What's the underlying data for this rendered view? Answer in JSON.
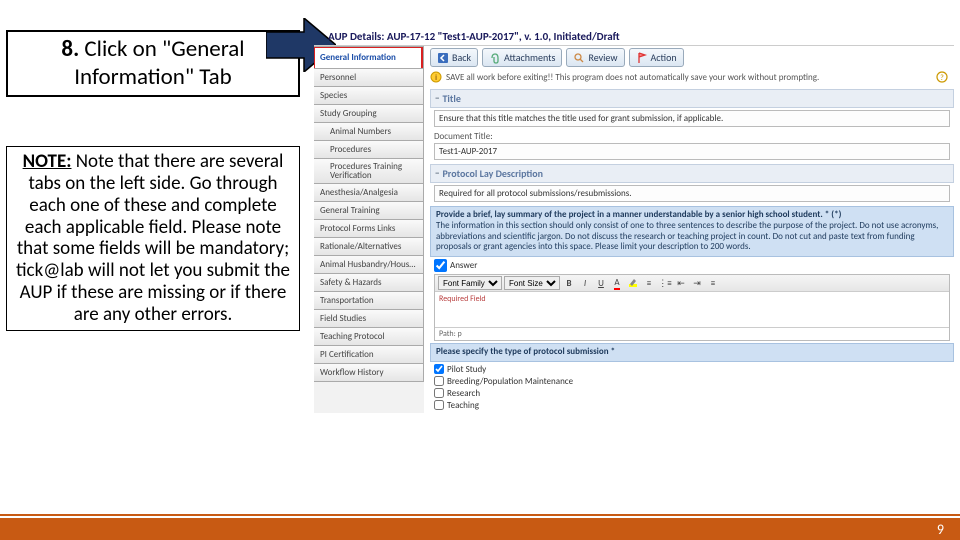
{
  "instruction": {
    "step": "8.",
    "text": "Click on \"General Information\" Tab"
  },
  "note": {
    "label": "NOTE:",
    "body": "Note that there are several tabs on the left side. Go through each one of these and complete each applicable field. Please note that some fields will be mandatory; tick@lab will not let you submit the AUP if these are missing or if there are any other errors."
  },
  "app": {
    "title": "AUP Details: AUP-17-12 \"Test1-AUP-2017\", v. 1.0, Initiated/Draft",
    "tabs": [
      "General Information",
      "Personnel",
      "Species",
      "Study Grouping",
      "Animal Numbers",
      "Procedures",
      "Procedures Training Verification",
      "Anesthesia/Analgesia",
      "General Training",
      "Protocol Forms Links",
      "Rationale/Alternatives",
      "Animal Husbandry/Housing",
      "Safety & Hazards",
      "Transportation",
      "Field Studies",
      "Teaching Protocol",
      "PI Certification",
      "Workflow History"
    ],
    "toolbar": {
      "back": "Back",
      "attachments": "Attachments",
      "review": "Review",
      "action": "Action"
    },
    "warn": "SAVE all work before exiting!! This program does not automatically save your work without prompting.",
    "title_section": {
      "hdr": "Title",
      "blurb": "Ensure that this title matches the title used for grant submission, if applicable.",
      "doc_label": "Document Title:",
      "doc_value": "Test1-AUP-2017"
    },
    "proto": {
      "hdr": "Protocol Lay Description",
      "blurb": "Required for all protocol submissions/resubmissions.",
      "q": {
        "head": "Provide a brief, lay summary of the project in a manner understandable by a senior high school student. * (*)",
        "body": "The information in this section should only consist of one to three sentences to describe the purpose of the project. Do not use acronyms, abbreviations and scientific jargon. Do not discuss the research or teaching project in count. Do not cut and paste text from funding proposals or grant agencies into this space. Please limit your description to 200 words."
      },
      "answer": "Answer",
      "rte": {
        "font_family": "Font Family",
        "font_size": "Font Size",
        "required": "Required Field",
        "path": "Path: p"
      },
      "spec": {
        "head": "Please specify the type of protocol submission *",
        "opts": [
          "Pilot Study",
          "Breeding/Population Maintenance",
          "Research",
          "Teaching"
        ]
      }
    }
  },
  "page_num": "9"
}
